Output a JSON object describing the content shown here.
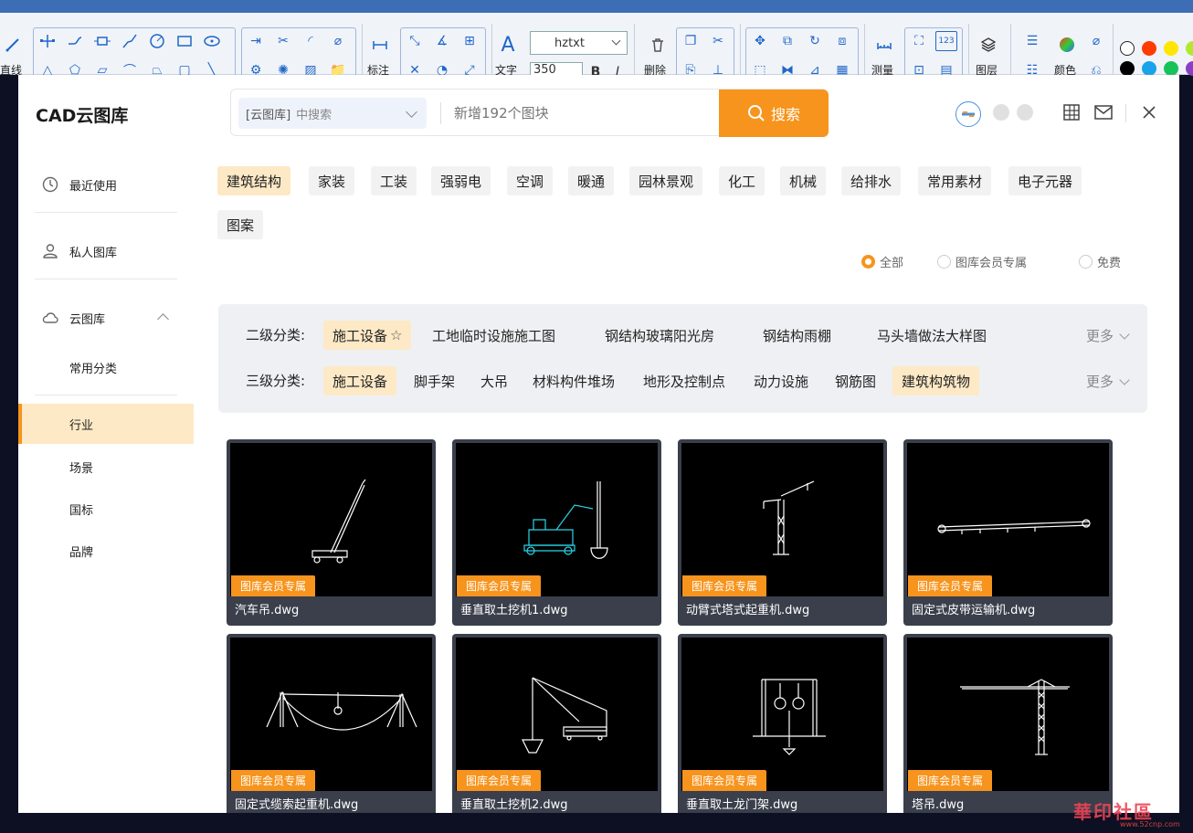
{
  "ribbon": {
    "line_label": "直线",
    "dim_label": "标注",
    "text_label": "文字",
    "font_value": "hztxt",
    "size_value": "350",
    "bold": "B",
    "italic": "I",
    "delete_label": "删除",
    "measure_label": "测量",
    "layer_label": "图层",
    "color_label": "颜色",
    "colors": [
      "#ffffff",
      "#ff3b00",
      "#ffe600",
      "#b3e830",
      "#000000",
      "#1aa3e8",
      "#18c25a",
      "#8b3fc4"
    ]
  },
  "dialog": {
    "title": "CAD云图库",
    "search": {
      "scope_label": "[云图库]",
      "scope_hint": "中搜索",
      "placeholder": "新增192个图块",
      "button": "搜索"
    }
  },
  "sidebar": {
    "recent": "最近使用",
    "private": "私人图库",
    "cloud": "云图库",
    "sub": [
      "常用分类",
      "行业",
      "场景",
      "国标",
      "品牌"
    ]
  },
  "categories": [
    "建筑结构",
    "家装",
    "工装",
    "强弱电",
    "空调",
    "暖通",
    "园林景观",
    "化工",
    "机械",
    "给排水",
    "常用素材",
    "电子元器",
    "图案"
  ],
  "filters": [
    "全部",
    "图库会员专属",
    "免费"
  ],
  "level2": {
    "label": "二级分类:",
    "items": [
      "施工设备",
      "工地临时设施施工图",
      "钢结构玻璃阳光房",
      "钢结构雨棚",
      "马头墙做法大样图"
    ],
    "more": "更多"
  },
  "level3": {
    "label": "三级分类:",
    "items": [
      "施工设备",
      "脚手架",
      "大吊",
      "材料构件堆场",
      "地形及控制点",
      "动力设施",
      "钢筋图",
      "建筑构筑物"
    ],
    "more": "更多"
  },
  "cards": [
    {
      "badge": "图库会员专属",
      "name": "汽车吊.dwg"
    },
    {
      "badge": "图库会员专属",
      "name": "垂直取土挖机1.dwg"
    },
    {
      "badge": "图库会员专属",
      "name": "动臂式塔式起重机.dwg"
    },
    {
      "badge": "图库会员专属",
      "name": "固定式皮带运输机.dwg"
    },
    {
      "badge": "图库会员专属",
      "name": "固定式缆索起重机.dwg"
    },
    {
      "badge": "图库会员专属",
      "name": "垂直取土挖机2.dwg"
    },
    {
      "badge": "图库会员专属",
      "name": "垂直取土龙门架.dwg"
    },
    {
      "badge": "图库会员专属",
      "name": "塔吊.dwg"
    }
  ],
  "watermark": "華印社區",
  "watermark_url": "www.52cnp.com"
}
